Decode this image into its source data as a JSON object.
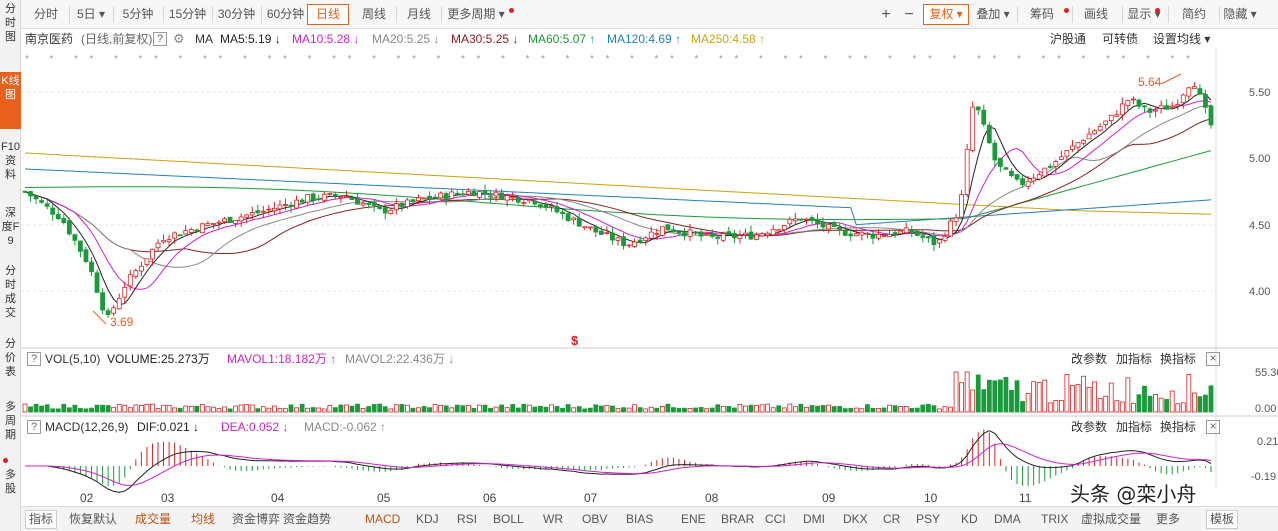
{
  "left_sidebar": [
    {
      "label": "分时图",
      "active": false
    },
    {
      "label": "K线图",
      "active": true
    },
    {
      "label": "F10资料",
      "active": false
    },
    {
      "label": "深度F9",
      "active": false
    },
    {
      "label": "分时成交",
      "active": false
    },
    {
      "label": "分价表",
      "active": false
    },
    {
      "label": "多周期",
      "active": false
    },
    {
      "label": "多股",
      "active": false
    }
  ],
  "period_tabs": [
    "分时",
    "5日",
    "5分钟",
    "15分钟",
    "30分钟",
    "60分钟",
    "日线",
    "周线",
    "月线",
    "更多周期"
  ],
  "toolbar": {
    "plus": "+",
    "minus": "−",
    "fuquan": "复权",
    "diejia": "叠加",
    "chouma": "筹码",
    "huaxian": "画线",
    "xianshi": "显示",
    "jianyue": "简约",
    "yincang": "隐藏"
  },
  "info": {
    "stock": "南京医药",
    "mode": "(日线,前复权)",
    "help": "?",
    "ma_label": "MA",
    "ma5": "MA5:5.19",
    "ma10": "MA10:5.28",
    "ma20": "MA20:5.25",
    "ma30": "MA30:5.25",
    "ma60": "MA60:5.07",
    "ma120": "MA120:4.69",
    "ma250": "MA250:4.58",
    "link1": "沪股通",
    "link2": "可转债",
    "link3": "设置均线"
  },
  "price_axis": [
    "5.50",
    "5.00",
    "4.50",
    "4.00"
  ],
  "annotations": {
    "low": "3.69",
    "high": "5.64",
    "marker": "$"
  },
  "vol": {
    "name": "VOL(5,10)",
    "volume": "VOLUME:25.273万",
    "mavol1": "MAVOL1:18.182万",
    "mavol2": "MAVOL2:22.436万",
    "axis": [
      "55.30",
      "0.00"
    ],
    "btn_params": "改参数",
    "btn_add": "加指标",
    "btn_switch": "换指标",
    "close": "×"
  },
  "macd": {
    "name": "MACD(12,26,9)",
    "dif": "DIF:0.021",
    "dea": "DEA:0.052",
    "macdv": "MACD:-0.062",
    "axis": [
      "0.21",
      "-0.19"
    ],
    "btn_params": "改参数",
    "btn_add": "加指标",
    "btn_switch": "换指标",
    "close": "×"
  },
  "months": [
    "02",
    "03",
    "04",
    "05",
    "06",
    "07",
    "08",
    "09",
    "10",
    "11"
  ],
  "bottom_tabs": [
    "指标",
    "恢复默认",
    "成交量",
    "均线",
    "资金博弈",
    "资金趋势",
    "MACD",
    "KDJ",
    "RSI",
    "BOLL",
    "WR",
    "OBV",
    "BIAS",
    "ENE",
    "BRAR",
    "CCI",
    "DMI",
    "DKX",
    "CR",
    "PSY",
    "KD",
    "DMA",
    "TRIX",
    "虚拟成交量",
    "更多",
    "模板"
  ],
  "watermark": "头条 @栾小舟",
  "colors": {
    "accent": "#e8601c",
    "up": "#e02020",
    "down": "#1a9a3a",
    "ma5": "#222222",
    "ma10": "#d020d0",
    "ma20": "#888888",
    "ma30": "#8b2020",
    "ma60": "#1a9a3a",
    "ma120": "#2080c0",
    "ma250": "#d0a010"
  }
}
